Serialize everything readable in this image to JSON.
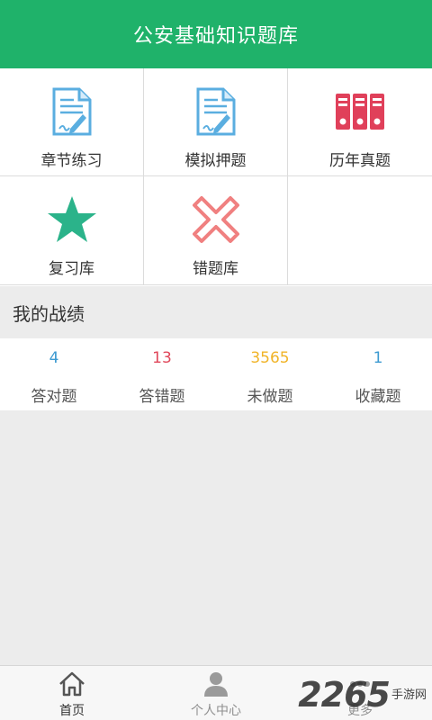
{
  "header": {
    "title": "公安基础知识题库"
  },
  "grid": {
    "items": [
      {
        "label": "章节练习",
        "icon": "document-pen-icon"
      },
      {
        "label": "模拟押题",
        "icon": "document-pen-icon"
      },
      {
        "label": "历年真题",
        "icon": "binders-icon"
      },
      {
        "label": "复习库",
        "icon": "star-icon"
      },
      {
        "label": "错题库",
        "icon": "cross-icon"
      }
    ]
  },
  "section": {
    "title": "我的战绩"
  },
  "stats": [
    {
      "value": "4",
      "label": "答对题",
      "color": "#3d9ad1"
    },
    {
      "value": "13",
      "label": "答错题",
      "color": "#e0475a"
    },
    {
      "value": "3565",
      "label": "未做题",
      "color": "#f0b429"
    },
    {
      "value": "1",
      "label": "收藏题",
      "color": "#3d9ad1"
    }
  ],
  "tabbar": {
    "items": [
      {
        "label": "首页",
        "icon": "home-icon",
        "active": true
      },
      {
        "label": "个人中心",
        "icon": "person-icon",
        "active": false
      },
      {
        "label": "更多",
        "icon": "more-icon",
        "active": false
      }
    ]
  },
  "watermark": {
    "number": "2265",
    "text": "手游网"
  },
  "colors": {
    "header": "#1fb26a",
    "star": "#2bb38a",
    "cross": "#f08080",
    "binder": "#e0405a",
    "doc": "#5aaee0"
  }
}
